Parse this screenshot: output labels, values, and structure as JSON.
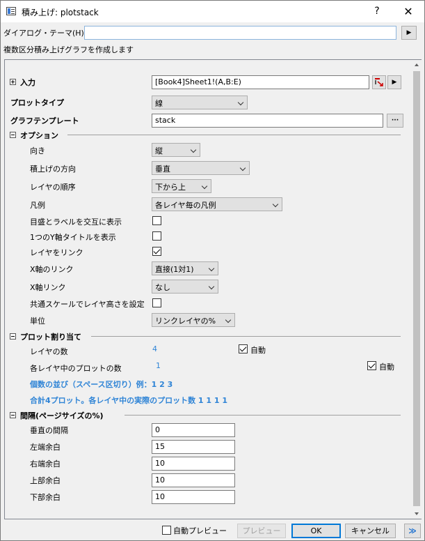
{
  "window": {
    "title": "積み上げ: plotstack",
    "help": "?",
    "close": "✕"
  },
  "theme": {
    "label": "ダイアログ・テーマ(H)",
    "value": "",
    "button": "▶"
  },
  "description": "複数区分積み上げグラフを作成します",
  "input": {
    "label": "入力",
    "value": "[Book4]Sheet1!(A,B:E)",
    "arrow": "▶"
  },
  "plot_type": {
    "label": "プロットタイプ",
    "value": "線"
  },
  "graph_template": {
    "label": "グラフテンプレート",
    "value": "stack",
    "browse": "···"
  },
  "options": {
    "header": "オプション",
    "orientation": {
      "label": "向き",
      "value": "縦"
    },
    "stack_direction": {
      "label": "積上げの方向",
      "value": "垂直"
    },
    "layer_order": {
      "label": "レイヤの順序",
      "value": "下から上"
    },
    "legend": {
      "label": "凡例",
      "value": "各レイヤ毎の凡例"
    },
    "alternate_ticks": {
      "label": "目盛とラベルを交互に表示",
      "checked": false
    },
    "one_y_title": {
      "label": "1つのY軸タイトルを表示",
      "checked": false
    },
    "link_layers": {
      "label": "レイヤをリンク",
      "checked": true
    },
    "x_axis_link": {
      "label": "X軸のリンク",
      "value": "直接(1対1)"
    },
    "x_link": {
      "label": "X軸リンク",
      "value": "なし"
    },
    "common_scale": {
      "label": "共通スケールでレイヤ高さを設定",
      "checked": false
    },
    "unit": {
      "label": "単位",
      "value": "リンクレイヤの%"
    }
  },
  "plot_assignment": {
    "header": "プロット割り当て",
    "num_layers": {
      "label": "レイヤの数",
      "value": "4",
      "auto_label": "自動",
      "auto": true
    },
    "plots_per_layer": {
      "label": "各レイヤ中のプロットの数",
      "value": "1",
      "auto_label": "自動",
      "auto": true
    },
    "hint1": "個数の並び（スペース区切り）例：1 2 3",
    "hint2": "合計4プロット。各レイヤ中の実際のプロット数 1 1 1 1"
  },
  "spacing": {
    "header": "間隔(ページサイズの%)",
    "vertical_gap": {
      "label": "垂直の間隔",
      "value": "0"
    },
    "left_margin": {
      "label": "左端余白",
      "value": "15"
    },
    "right_margin": {
      "label": "右端余白",
      "value": "10"
    },
    "top_margin": {
      "label": "上部余白",
      "value": "10"
    },
    "bottom_margin": {
      "label": "下部余白",
      "value": "10"
    }
  },
  "footer": {
    "auto_preview": {
      "label": "自動プレビュー",
      "checked": false
    },
    "preview": "プレビュー",
    "ok": "OK",
    "cancel": "キャンセル",
    "more": "≫"
  }
}
